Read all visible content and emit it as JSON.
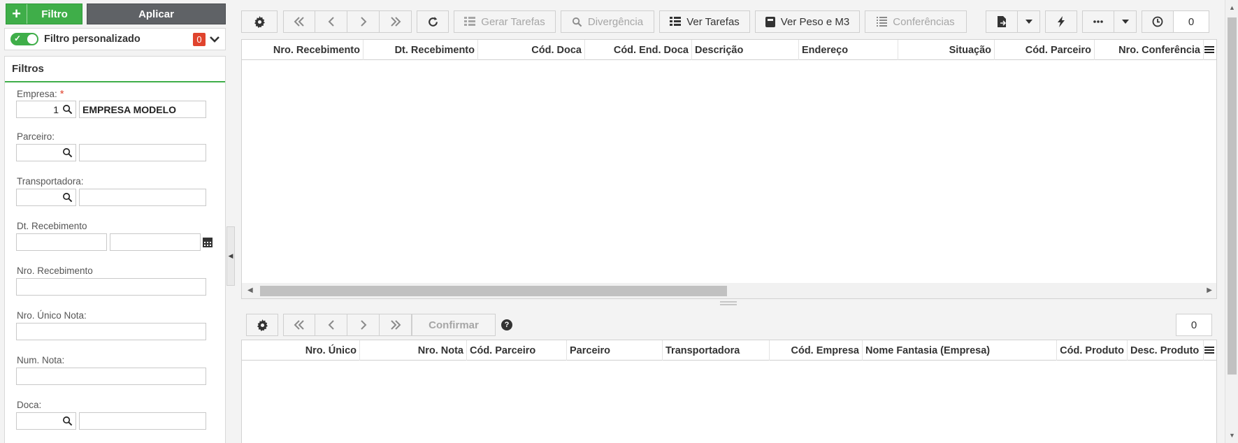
{
  "left": {
    "filtro_button": "Filtro",
    "aplicar_button": "Aplicar",
    "filtro_personalizado": "Filtro personalizado",
    "filtro_count": "0",
    "filters_title": "Filtros",
    "fields": {
      "empresa": {
        "label": "Empresa:",
        "required_mark": "*",
        "code": "1",
        "name": "EMPRESA MODELO"
      },
      "parceiro": {
        "label": "Parceiro:",
        "code": "",
        "name": ""
      },
      "transportadora": {
        "label": "Transportadora:",
        "code": "",
        "name": ""
      },
      "dt_recebimento": {
        "label": "Dt. Recebimento",
        "from": "",
        "to": ""
      },
      "nro_recebimento": {
        "label": "Nro. Recebimento",
        "value": ""
      },
      "nro_unico_nota": {
        "label": "Nro. Único Nota:",
        "value": ""
      },
      "num_nota": {
        "label": "Num. Nota:",
        "value": ""
      },
      "doca": {
        "label": "Doca:",
        "code": "",
        "name": ""
      }
    }
  },
  "top_toolbar": {
    "gerar_tarefas": "Gerar Tarefas",
    "divergencia": "Divergência",
    "ver_tarefas": "Ver Tarefas",
    "ver_peso": "Ver Peso e M3",
    "conferencias": "Conferências",
    "record_count": "0"
  },
  "top_grid": {
    "columns": [
      "Nro. Recebimento",
      "Dt. Recebimento",
      "Cód. Doca",
      "Cód. End. Doca",
      "Descrição",
      "Endereço",
      "Situação",
      "Cód. Parceiro",
      "Nro. Conferência"
    ]
  },
  "bottom_toolbar": {
    "confirmar": "Confirmar",
    "help": "?",
    "record_count": "0"
  },
  "bottom_grid": {
    "columns": [
      "Nro. Único",
      "Nro. Nota",
      "Cód. Parceiro",
      "Parceiro",
      "Transportadora",
      "Cód. Empresa",
      "Nome Fantasia (Empresa)",
      "Cód. Produto",
      "Desc. Produto"
    ]
  },
  "colors": {
    "green": "#3fae49",
    "dark_button": "#5f6266",
    "badge": "#e0442e"
  }
}
